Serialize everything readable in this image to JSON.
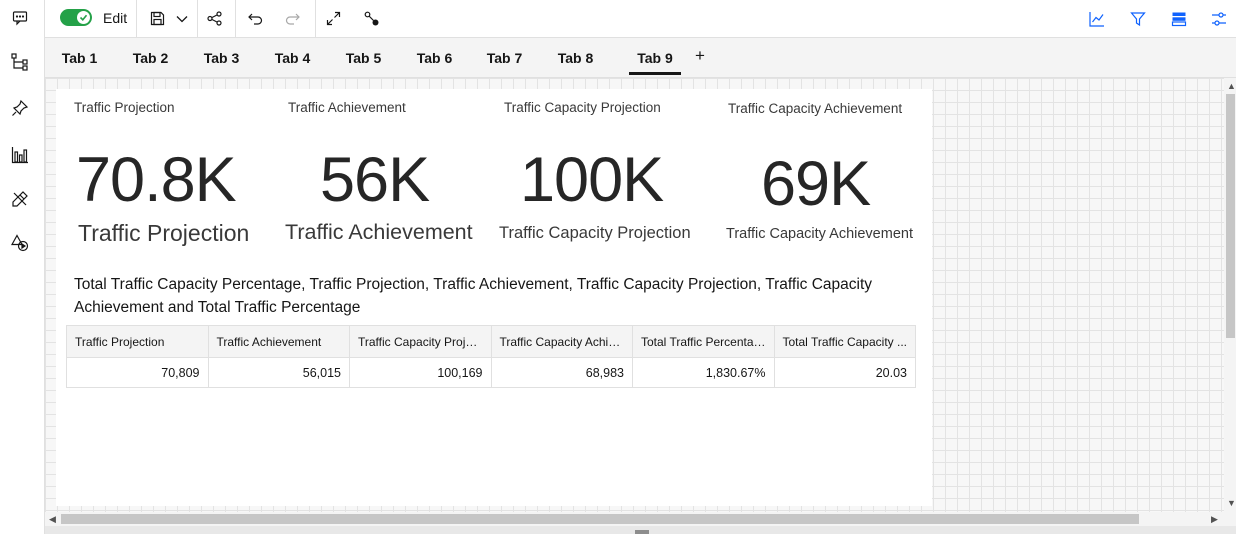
{
  "toolbar": {
    "edit_label": "Edit",
    "edit_mode_on": true,
    "accent_color": "#24a148"
  },
  "icons": {
    "rail": [
      "comment-icon",
      "tree-icon",
      "pin-icon",
      "bar-chart-icon",
      "design-tools-icon",
      "shapes-icon"
    ],
    "toolbar_left": [
      "save-icon",
      "chevron-down-icon",
      "share-icon",
      "undo-icon",
      "redo-icon",
      "maximize-icon",
      "pipeline-icon"
    ],
    "toolbar_right": [
      "line-chart-icon",
      "filter-icon",
      "data-view-icon",
      "settings-adjust-icon"
    ]
  },
  "tabs": [
    {
      "label": "Tab 1"
    },
    {
      "label": "Tab 2"
    },
    {
      "label": "Tab 3"
    },
    {
      "label": "Tab 4"
    },
    {
      "label": "Tab 5"
    },
    {
      "label": "Tab 6"
    },
    {
      "label": "Tab 7"
    },
    {
      "label": "Tab 8"
    },
    {
      "label": "Tab 9",
      "active": true
    }
  ],
  "tab_add_label": "+",
  "kpis": [
    {
      "header": "Traffic Projection",
      "value": "70.8K",
      "sublabel": "Traffic Projection"
    },
    {
      "header": "Traffic Achievement",
      "value": "56K",
      "sublabel": "Traffic Achievement"
    },
    {
      "header": "Traffic Capacity Projection",
      "value": "100K",
      "sublabel": "Traffic Capacity Projection"
    },
    {
      "header": "Traffic Capacity Achievement",
      "value": "69K",
      "sublabel": "Traffic Capacity Achievement"
    }
  ],
  "table": {
    "title": "Total Traffic Capacity Percentage, Traffic Projection, Traffic Achievement, Traffic Capacity Projection, Traffic Capacity Achievement and Total Traffic Percentage",
    "columns": [
      "Traffic Projection",
      "Traffic Achievement",
      "Traffic Capacity Projec...",
      "Traffic Capacity Achie...",
      "Total Traffic Percentage",
      "Total Traffic Capacity ..."
    ],
    "rows": [
      [
        "70,809",
        "56,015",
        "100,169",
        "68,983",
        "1,830.67%",
        "20.03"
      ]
    ]
  }
}
